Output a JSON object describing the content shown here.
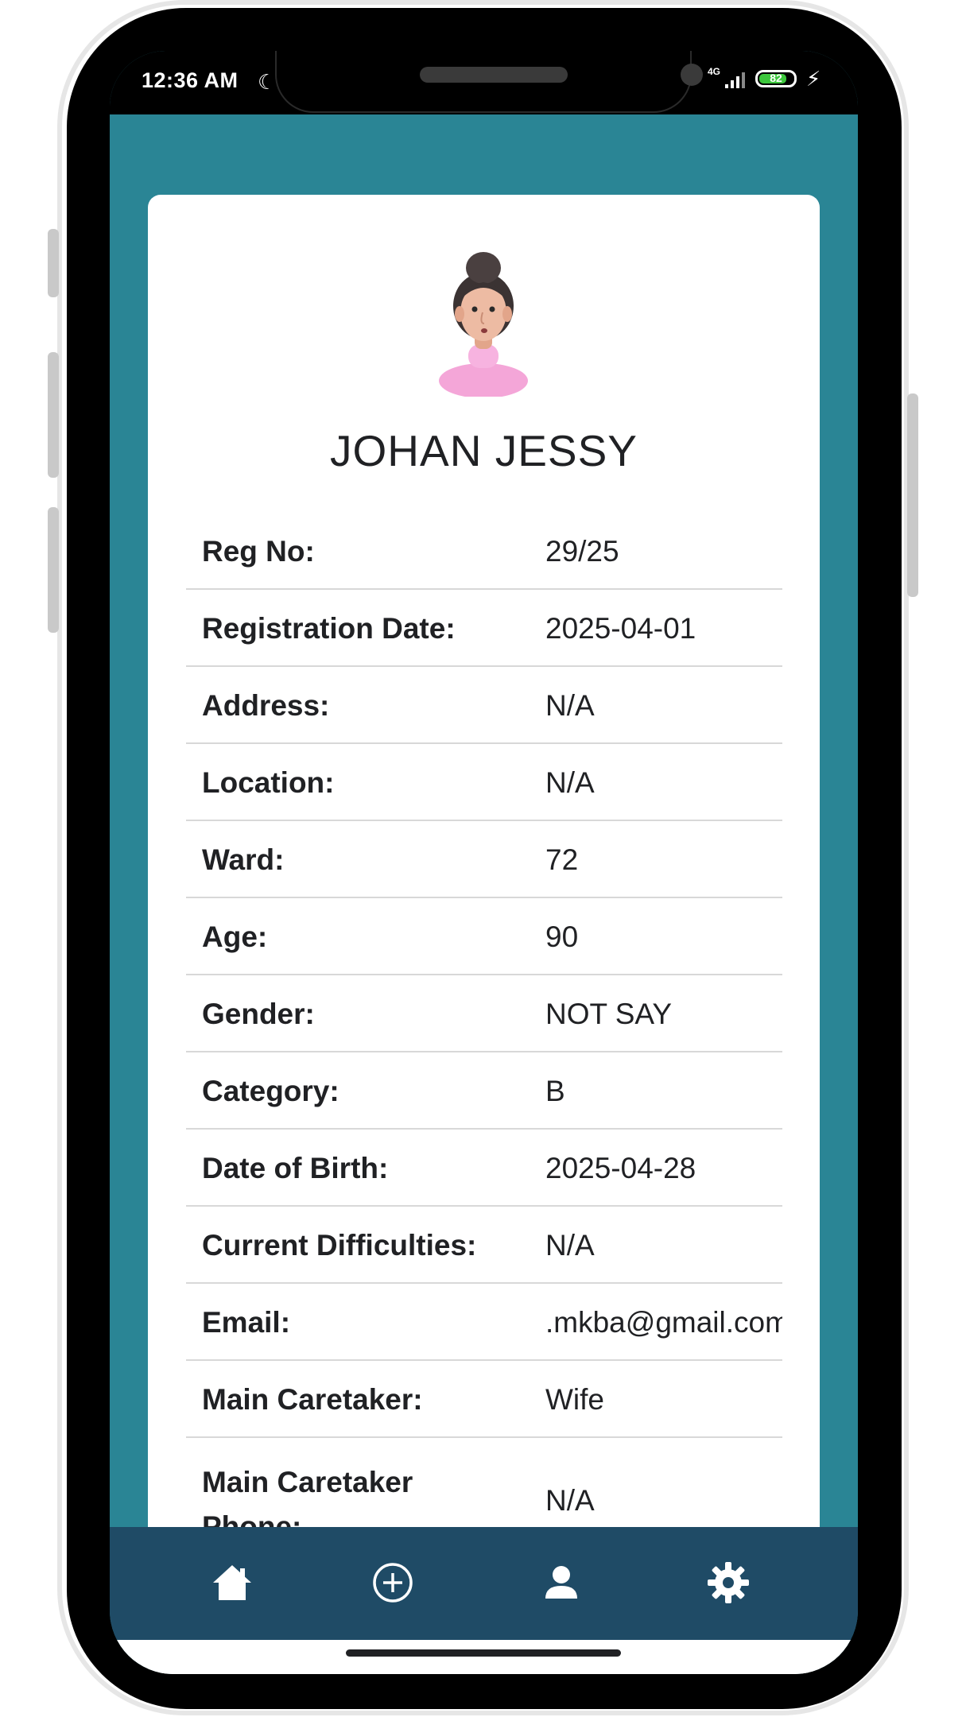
{
  "status_bar": {
    "time": "12:36 AM",
    "network": "4G",
    "battery_level": "82",
    "battery_fraction": 0.82
  },
  "profile": {
    "name": "JOHAN JESSY",
    "fields": [
      {
        "label": "Reg No:",
        "value": "29/25"
      },
      {
        "label": "Registration Date:",
        "value": "2025-04-01"
      },
      {
        "label": "Address:",
        "value": "N/A"
      },
      {
        "label": "Location:",
        "value": "N/A"
      },
      {
        "label": "Ward:",
        "value": "72"
      },
      {
        "label": "Age:",
        "value": "90"
      },
      {
        "label": "Gender:",
        "value": "NOT SAY"
      },
      {
        "label": "Category:",
        "value": "B"
      },
      {
        "label": "Date of Birth:",
        "value": "2025-04-28"
      },
      {
        "label": "Current Difficulties:",
        "value": "N/A"
      },
      {
        "label": "Email:",
        "value": ".mkba@gmail.com"
      },
      {
        "label": "Main Caretaker:",
        "value": "Wife"
      },
      {
        "label": "Main Caretaker Phone:",
        "value": "N/A"
      }
    ]
  },
  "bottom_nav": [
    {
      "icon": "home-icon"
    },
    {
      "icon": "add-circle-icon"
    },
    {
      "icon": "person-icon"
    },
    {
      "icon": "gear-icon"
    }
  ],
  "colors": {
    "background_teal": "#2a8595",
    "nav_bar": "#1f4b66",
    "card": "#ffffff",
    "battery_green": "#3cc63c"
  }
}
